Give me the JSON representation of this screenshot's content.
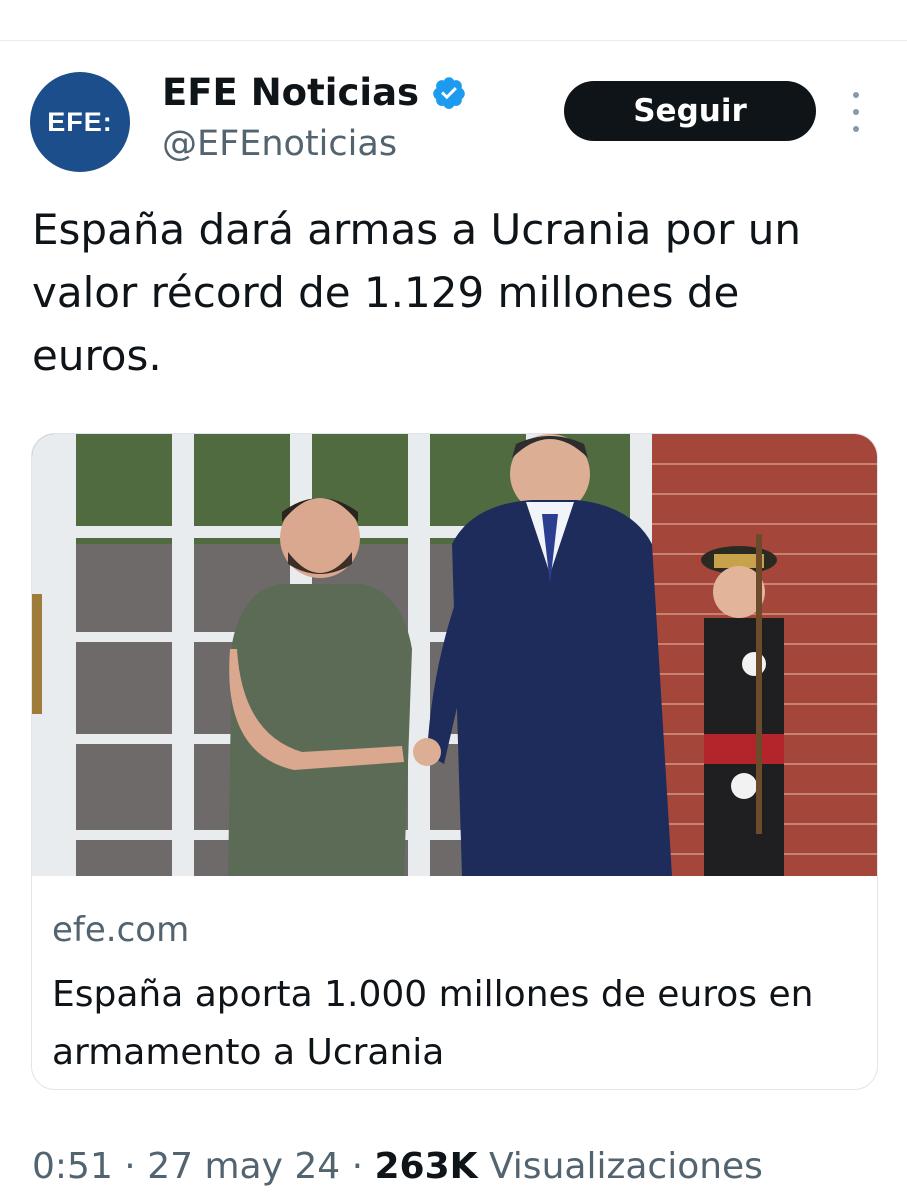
{
  "author": {
    "avatar_text": "EFE:",
    "display_name": "EFE Noticias",
    "handle": "@EFEnoticias",
    "verified": true
  },
  "actions": {
    "follow_label": "Seguir"
  },
  "tweet": {
    "text": "España dará armas a Ucrania por un valor récord de 1.129 millones de euros."
  },
  "link_card": {
    "domain": "efe.com",
    "title": "España aporta 1.000 millones de euros en armamento a Ucrania"
  },
  "meta": {
    "time": "0:51",
    "separator": " · ",
    "date": "27 may 24",
    "views_count": "263K",
    "views_label": "Visualizaciones"
  },
  "colors": {
    "avatar_bg": "#1c4e8c",
    "verified_blue": "#1d9bf0",
    "follow_bg": "#0f1419",
    "secondary_text": "#536471"
  }
}
